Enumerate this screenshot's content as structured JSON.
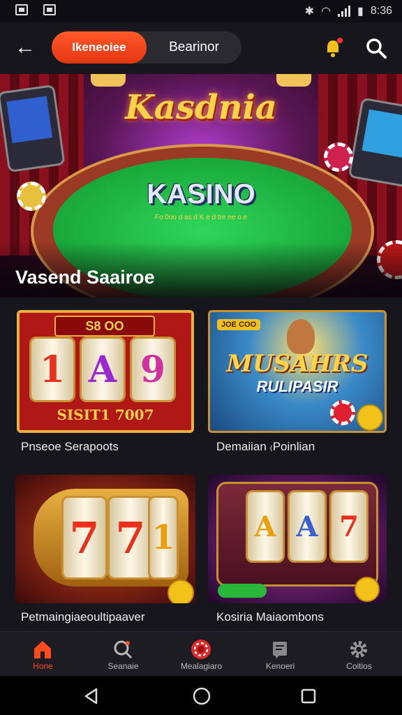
{
  "status_bar": {
    "time": "8:36"
  },
  "header": {
    "tabs": [
      {
        "label": "Ikeneoiee",
        "active": true
      },
      {
        "label": "Bearinor",
        "active": false
      }
    ]
  },
  "hero": {
    "banner_title": "Kasdnia",
    "table_label": "KASINO",
    "table_sub": "Fo 0oo d as d K e d tre ee o e",
    "caption": "Vasend Saairoe"
  },
  "cards": [
    {
      "title": "Pnseoe Serapoots",
      "banner": "S8 OO",
      "reels": [
        "1",
        "A",
        "9"
      ],
      "footer": "SISIT1 7007"
    },
    {
      "title": "Demaiian ₍Poinlian",
      "badge": "JOE COO",
      "line1": "MUSAHRS",
      "line2": "RULIPASIR"
    },
    {
      "title": "Petmaingiaeoultipaaver",
      "reels": [
        "7",
        "7",
        "1"
      ]
    },
    {
      "title": "Kosiria Maiaombons",
      "reels": [
        "A",
        "A",
        "7"
      ],
      "button": ""
    }
  ],
  "bottom_nav": [
    {
      "label": "Hone",
      "icon": "home-icon",
      "active": true
    },
    {
      "label": "Seanaie",
      "icon": "search-icon",
      "active": false
    },
    {
      "label": "Mealagiaro",
      "icon": "casino-chip-icon",
      "active": false
    },
    {
      "label": "Kenoeri",
      "icon": "document-icon",
      "active": false
    },
    {
      "label": "Coitios",
      "icon": "gear-icon",
      "active": false
    }
  ],
  "colors": {
    "accent": "#ff4a1c",
    "background": "#16161c",
    "nav_active": "#ff4a1c"
  }
}
